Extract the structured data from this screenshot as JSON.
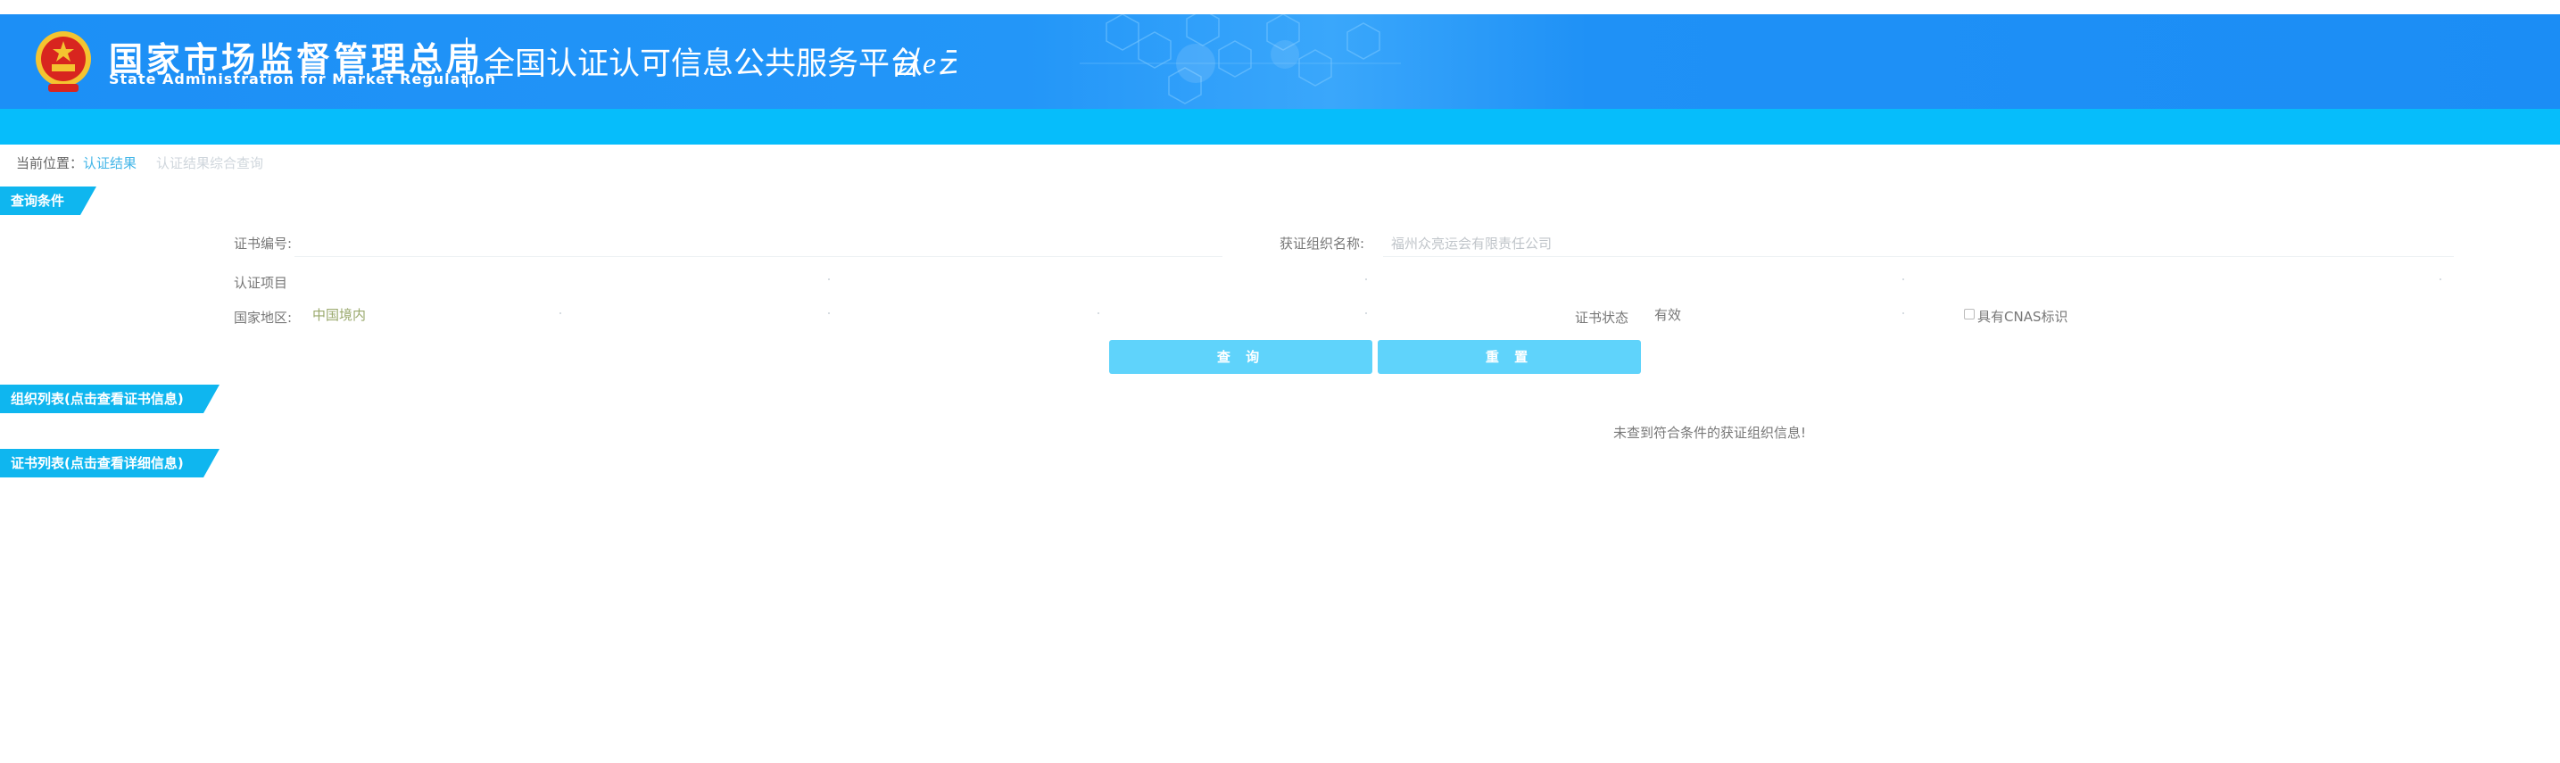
{
  "header": {
    "agency_cn": "国家市场监督管理总局",
    "agency_en": "State Administration  for  Market Regulation",
    "platform_title": "全国认证认可信息公共服务平台",
    "logo_mark": "认e云",
    "colors": {
      "header_blue": "#1c8ff6",
      "subbar_cyan": "#06bdfb"
    }
  },
  "breadcrumb": {
    "label": "当前位置：",
    "link": "认证结果",
    "current": "认证结果综合查询"
  },
  "sections": {
    "query": "查询条件",
    "org_list": "组织列表(点击查看证书信息)",
    "cert_list": "证书列表(点击查看详细信息)"
  },
  "form": {
    "cert_no_label": "证书编号:",
    "cert_no_value": "",
    "org_name_label": "获证组织名称:",
    "org_name_value": "福州众亮运会有限责任公司",
    "cert_item_label": "认证项目",
    "cert_item_value": "",
    "region_label": "国家地区:",
    "region_value": "中国境内",
    "status_label": "证书状态",
    "status_value": "有效",
    "cnas_label": "具有CNAS标识",
    "cnas_checked": false
  },
  "buttons": {
    "search": "查 询",
    "reset": "重 置",
    "color": "#5fd3fb"
  },
  "results": {
    "empty_message": "未查到符合条件的获证组织信息!"
  }
}
